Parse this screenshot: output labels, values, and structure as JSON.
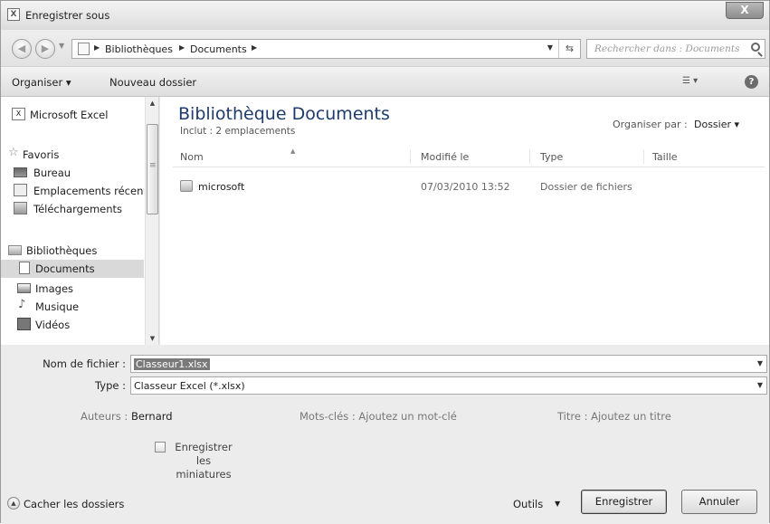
{
  "window": {
    "title": "Enregistrer sous",
    "close_label": "X"
  },
  "address": {
    "crumbs": [
      "Bibliothèques",
      "Documents"
    ],
    "search_placeholder": "Rechercher dans : Documents"
  },
  "toolbar": {
    "organize": "Organiser",
    "new_folder": "Nouveau dossier"
  },
  "nav": {
    "items": [
      {
        "label": "Microsoft Excel",
        "icon": "excel-icon"
      },
      {
        "label": "Favoris",
        "icon": "star-icon"
      },
      {
        "label": "Bureau",
        "icon": "desktop-icon"
      },
      {
        "label": "Emplacements récents",
        "icon": "recent-places-icon"
      },
      {
        "label": "Téléchargements",
        "icon": "downloads-icon"
      },
      {
        "label": "Bibliothèques",
        "icon": "libraries-icon"
      },
      {
        "label": "Documents",
        "icon": "document-icon"
      },
      {
        "label": "Images",
        "icon": "images-icon"
      },
      {
        "label": "Musique",
        "icon": "music-icon"
      },
      {
        "label": "Vidéos",
        "icon": "videos-icon"
      }
    ]
  },
  "content": {
    "title": "Bibliothèque Documents",
    "subtitle": "Inclut : 2 emplacements",
    "arrange_label": "Organiser par :",
    "arrange_value": "Dossier",
    "columns": [
      "Nom",
      "Modifié le",
      "Type",
      "Taille"
    ],
    "rows": [
      {
        "name": "microsoft",
        "modified": "07/03/2010 13:52",
        "type": "Dossier de fichiers",
        "size": ""
      }
    ]
  },
  "form": {
    "filename_label": "Nom de fichier :",
    "filename_value": "Classeur1.xlsx",
    "type_label": "Type :",
    "type_value": "Classeur Excel (*.xlsx)",
    "authors_label": "Auteurs :",
    "authors_value": "Bernard",
    "keywords_label": "Mots-clés :",
    "keywords_value": "Ajoutez un mot-clé",
    "title_label": "Titre :",
    "title_value": "Ajoutez un titre",
    "thumbnail_label": "Enregistrer les miniatures",
    "hide_folders": "Cacher les dossiers",
    "tools": "Outils",
    "save": "Enregistrer",
    "cancel": "Annuler"
  }
}
